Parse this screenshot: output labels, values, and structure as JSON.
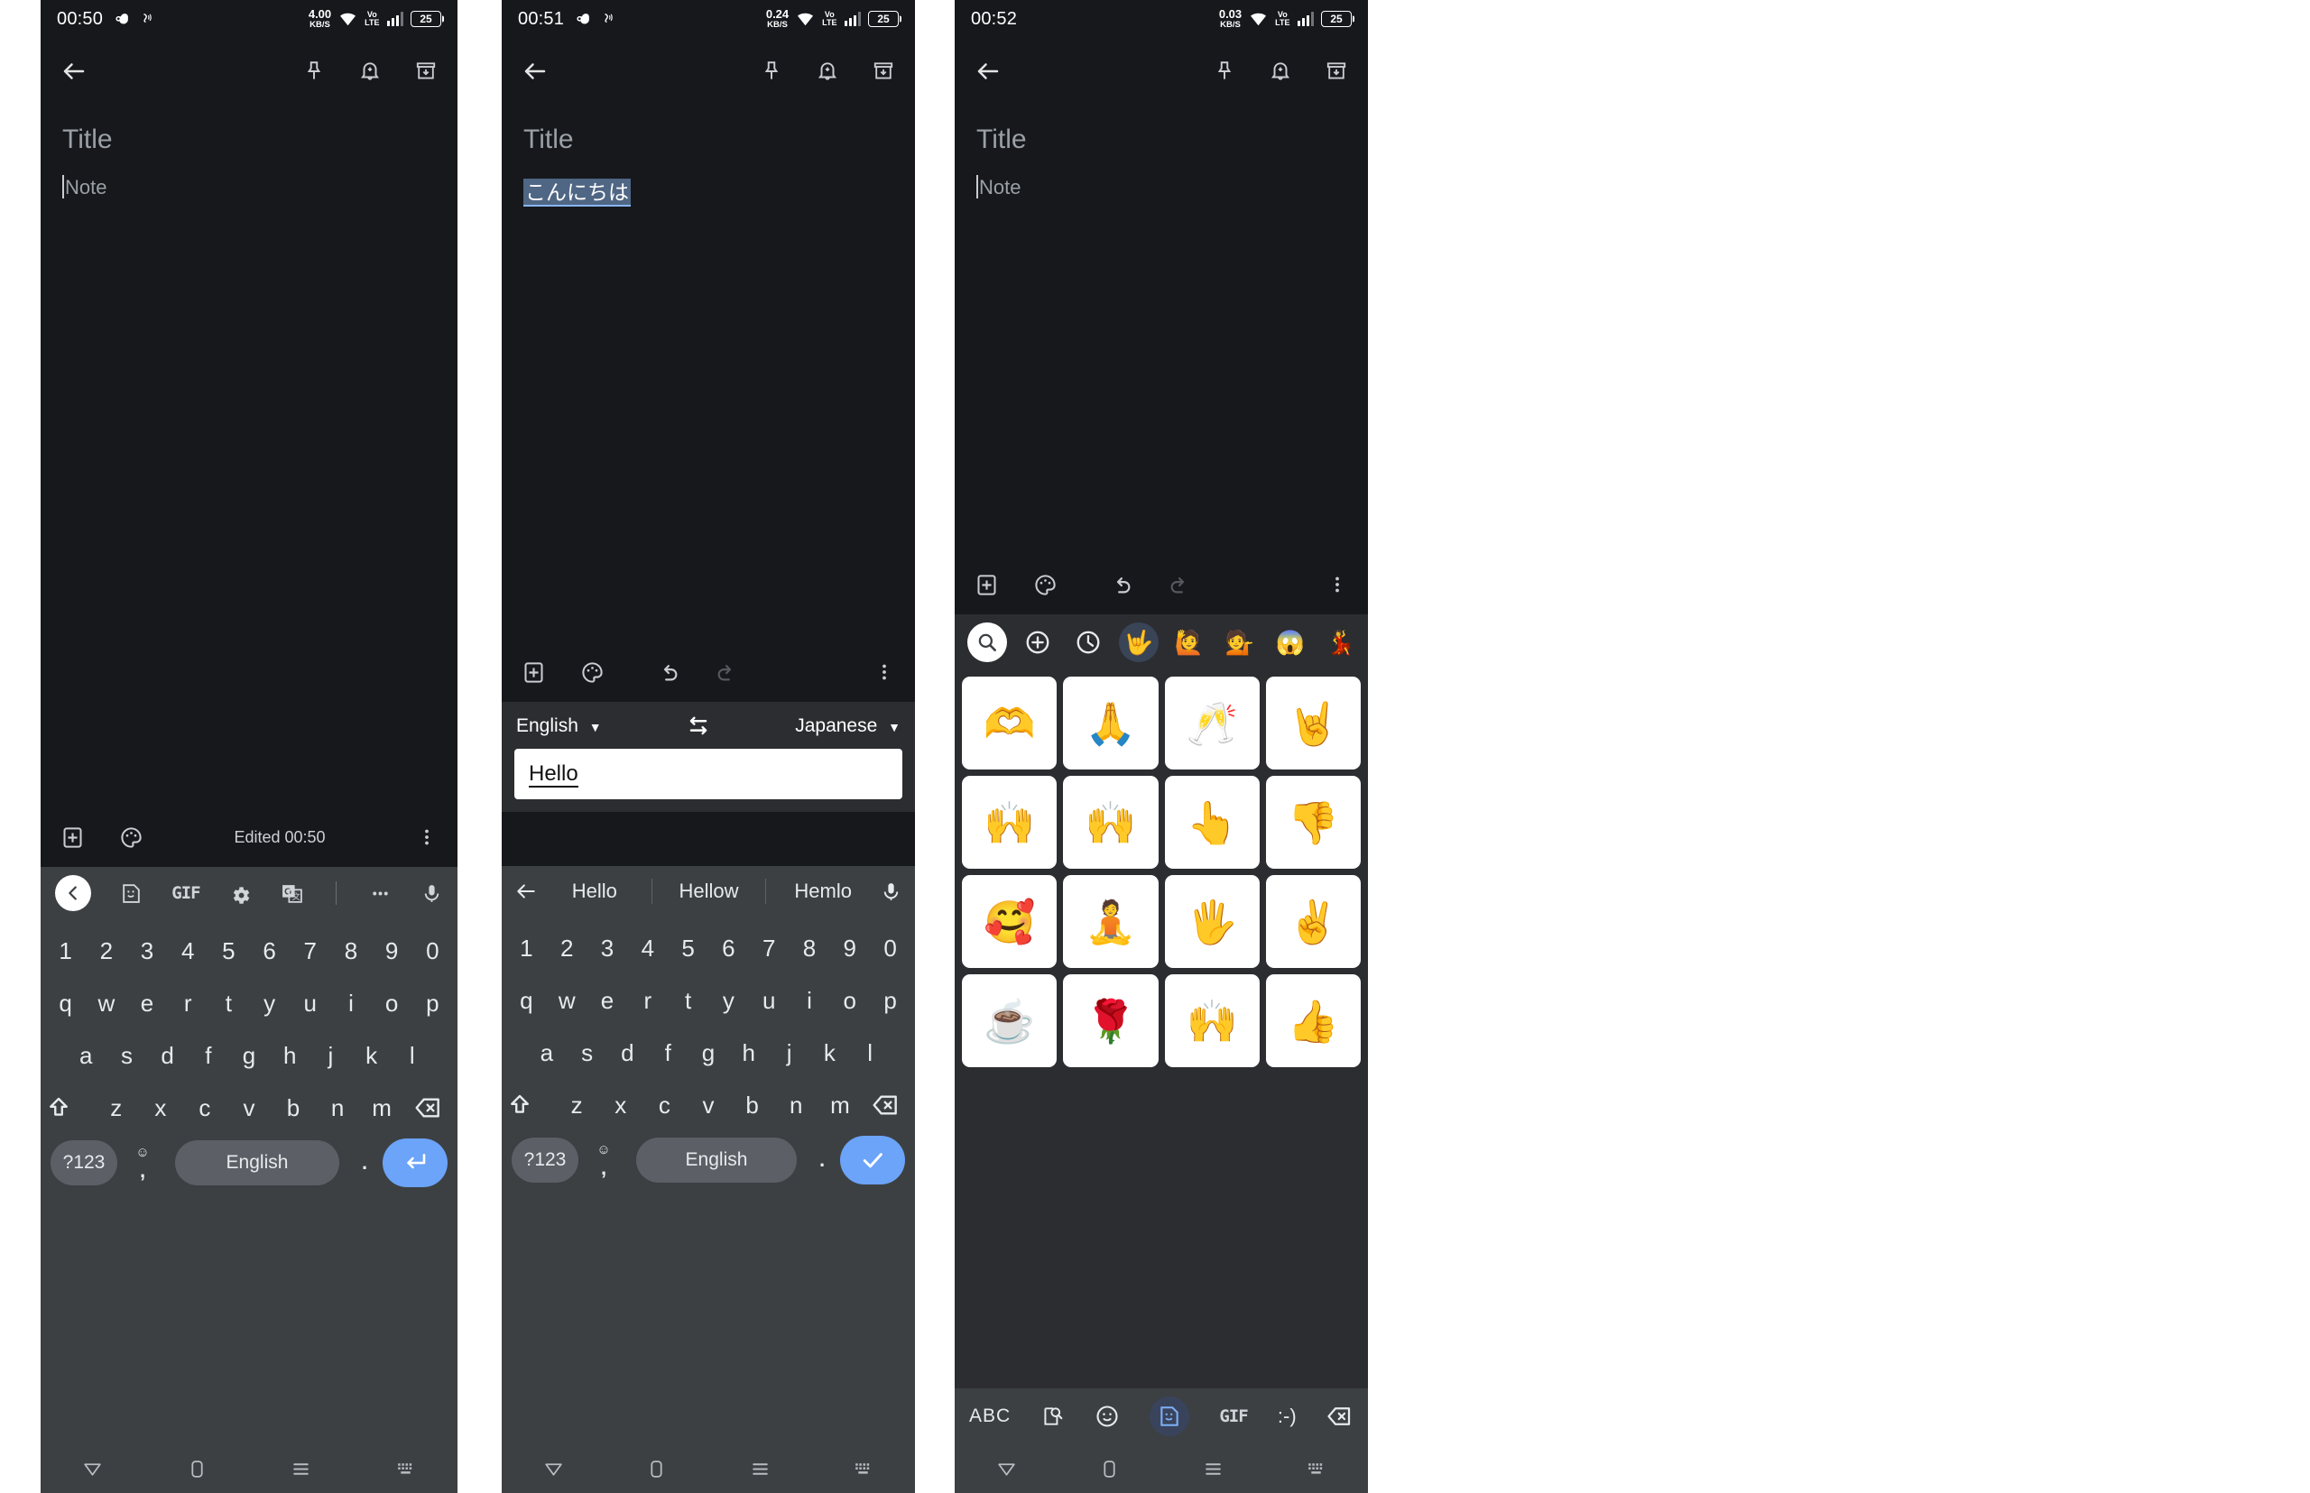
{
  "meta": {
    "app": "Google Keep note editor with Gboard",
    "accent_blue": "#6ba4f8",
    "selection_blue": "#4f6684",
    "panel_bg": "#16181c",
    "keyboard_bg": "#3c4043"
  },
  "panels": [
    {
      "id": "panel-1",
      "status": {
        "time": "00:50",
        "net_rate": "4.00",
        "net_unit": "KB/S",
        "volte_top": "Vo",
        "volte_bottom": "LTE",
        "battery": "25"
      },
      "appbar": {
        "back": "back-arrow",
        "pin": "pin",
        "reminder": "add-reminder",
        "archive": "archive"
      },
      "note": {
        "title_placeholder": "Title",
        "body_placeholder": "Note",
        "body_value": ""
      },
      "note_toolbar": {
        "add": "add-box",
        "palette": "palette",
        "status": "Edited 00:50",
        "overflow": "more-vertical"
      },
      "keyboard": {
        "toolbar": [
          "back-chevron",
          "sticker",
          "GIF",
          "settings",
          "translate",
          "more",
          "mic"
        ],
        "gif_label": "GIF",
        "rows": {
          "numbers": [
            "1",
            "2",
            "3",
            "4",
            "5",
            "6",
            "7",
            "8",
            "9",
            "0"
          ],
          "row1": [
            "q",
            "w",
            "e",
            "r",
            "t",
            "y",
            "u",
            "i",
            "o",
            "p"
          ],
          "row2": [
            "a",
            "s",
            "d",
            "f",
            "g",
            "h",
            "j",
            "k",
            "l"
          ],
          "row3": [
            "z",
            "x",
            "c",
            "v",
            "b",
            "n",
            "m"
          ]
        },
        "bottom": {
          "symbols": "?123",
          "emoji": "emoji",
          "comma": ",",
          "space": "English",
          "period": ".",
          "enter": "enter-arrow"
        }
      }
    },
    {
      "id": "panel-2",
      "status": {
        "time": "00:51",
        "net_rate": "0.24",
        "net_unit": "KB/S",
        "volte_top": "Vo",
        "volte_bottom": "LTE",
        "battery": "25"
      },
      "appbar": {
        "back": "back-arrow",
        "pin": "pin",
        "reminder": "add-reminder",
        "archive": "archive"
      },
      "note": {
        "title_placeholder": "Title",
        "body_value": "こんにちは"
      },
      "note_toolbar": {
        "add": "add-box",
        "palette": "palette",
        "undo": "undo",
        "redo": "redo",
        "overflow": "more-vertical"
      },
      "translate": {
        "source_lang": "English",
        "target_lang": "Japanese",
        "swap": "swap-arrows",
        "input_value": "Hello"
      },
      "keyboard": {
        "suggestions": [
          "Hello",
          "Hellow",
          "Hemlo"
        ],
        "back": "back-arrow",
        "mic": "mic",
        "rows": {
          "numbers": [
            "1",
            "2",
            "3",
            "4",
            "5",
            "6",
            "7",
            "8",
            "9",
            "0"
          ],
          "row1": [
            "q",
            "w",
            "e",
            "r",
            "t",
            "y",
            "u",
            "i",
            "o",
            "p"
          ],
          "row2": [
            "a",
            "s",
            "d",
            "f",
            "g",
            "h",
            "j",
            "k",
            "l"
          ],
          "row3": [
            "z",
            "x",
            "c",
            "v",
            "b",
            "n",
            "m"
          ]
        },
        "bottom": {
          "symbols": "?123",
          "emoji": "emoji",
          "comma": ",",
          "space": "English",
          "period": ".",
          "enter": "check"
        }
      }
    },
    {
      "id": "panel-3",
      "status": {
        "time": "00:52",
        "net_rate": "0.03",
        "net_unit": "KB/S",
        "volte_top": "Vo",
        "volte_bottom": "LTE",
        "battery": "25"
      },
      "appbar": {
        "back": "back-arrow",
        "pin": "pin",
        "reminder": "add-reminder",
        "archive": "archive"
      },
      "note": {
        "title_placeholder": "Title",
        "body_placeholder": "Note",
        "body_value": ""
      },
      "note_toolbar": {
        "add": "add-box",
        "palette": "palette",
        "undo": "undo",
        "redo": "redo",
        "overflow": "more-vertical"
      },
      "stickers": {
        "categories": [
          {
            "name": "search",
            "glyph": ""
          },
          {
            "name": "add-pack",
            "glyph": ""
          },
          {
            "name": "recent",
            "glyph": ""
          },
          {
            "name": "pack-rock-hand",
            "glyph": "🤟",
            "selected": true
          },
          {
            "name": "pack-yellow-character",
            "glyph": "🙋"
          },
          {
            "name": "pack-purple-character",
            "glyph": "💁"
          },
          {
            "name": "pack-shock-face",
            "glyph": "😱"
          },
          {
            "name": "pack-sari-woman",
            "glyph": "💃"
          }
        ],
        "grid": [
          "🫶",
          "🙏",
          "🥂",
          "🤘",
          "🙌",
          "🙌",
          "👆",
          "👎",
          "🥰",
          "🧘",
          "🖐",
          "✌",
          "☕",
          "🌹",
          "🙌",
          "👍"
        ],
        "bottom_bar": [
          "ABC",
          "image-search",
          "emoji",
          "sticker",
          "GIF",
          ":-)",
          "backspace"
        ],
        "abc_label": "ABC",
        "gif_label": "GIF",
        "emoticon_label": ":-)"
      }
    }
  ],
  "navbar": {
    "back": "back-triangle",
    "home": "home-square",
    "recents": "recents-lines",
    "keyboard": "keyboard-toggle"
  }
}
